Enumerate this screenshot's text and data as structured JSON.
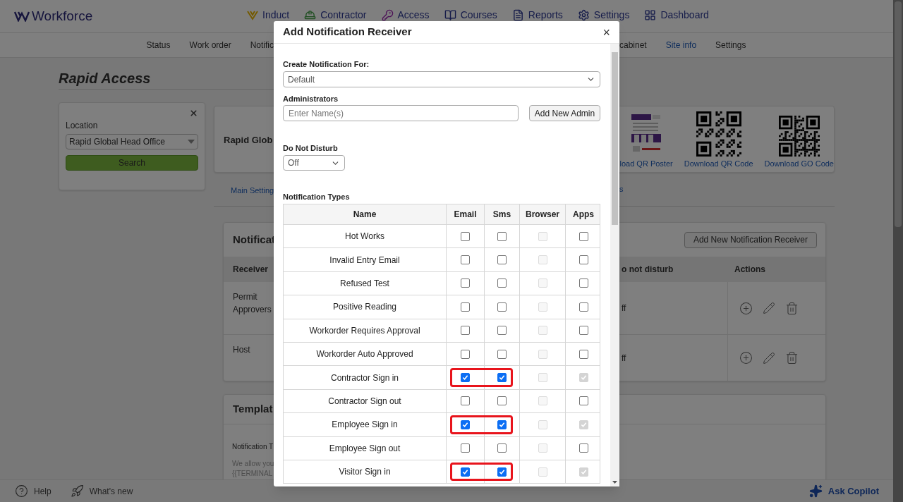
{
  "app": {
    "logo": "Workforce"
  },
  "nav": [
    {
      "label": "Induct",
      "kind": "induct"
    },
    {
      "label": "Contractor",
      "kind": "contractor"
    },
    {
      "label": "Access",
      "kind": "access"
    },
    {
      "label": "Courses",
      "kind": "courses"
    },
    {
      "label": "Reports",
      "kind": "reports"
    },
    {
      "label": "Settings",
      "kind": "settings"
    },
    {
      "label": "Dashboard",
      "kind": "dashboard"
    }
  ],
  "subnav": {
    "left": [
      {
        "label": "Status",
        "selected": false
      },
      {
        "label": "Work order",
        "selected": false
      },
      {
        "label": "Notific",
        "selected": false
      }
    ],
    "right": [
      {
        "label": "cabinet",
        "selected": false
      },
      {
        "label": "Site info",
        "selected": true
      },
      {
        "label": "Settings",
        "selected": false
      }
    ]
  },
  "page": {
    "title": "Rapid Access"
  },
  "location_panel": {
    "label": "Location",
    "value": "Rapid Global Head Office",
    "button": "Search"
  },
  "site_card": {
    "name": "Rapid Glob",
    "downloads": [
      {
        "label": "load QR Poster",
        "kind": "poster"
      },
      {
        "label": "Download QR Code",
        "kind": "qr"
      },
      {
        "label": "Download GO Code",
        "kind": "go"
      }
    ]
  },
  "tabs": [
    {
      "label": "Main Setting"
    },
    {
      "label": "s"
    }
  ],
  "notifications_card": {
    "title": "Notificat",
    "button": "Add New Notification Receiver",
    "columns": [
      "Receiver",
      "o not disturb",
      "Actions"
    ],
    "rows": [
      {
        "receiver": "Permit Approvers",
        "dnd": "ff"
      },
      {
        "receiver": "Host",
        "dnd": "ff"
      }
    ]
  },
  "template_card": {
    "title": "Templat",
    "label": "Notification T",
    "lines": [
      "We allow you",
      "{{TERMINAL"
    ]
  },
  "footer": {
    "help": "Help",
    "whats_new": "What's new",
    "copilot": "Ask Copilot"
  },
  "modal": {
    "title": "Add Notification Receiver",
    "close": "×",
    "create_for": {
      "label": "Create Notification For:",
      "value": "Default"
    },
    "administrators": {
      "label": "Administrators",
      "placeholder": "Enter Name(s)",
      "button": "Add New Admin"
    },
    "do_not_disturb": {
      "label": "Do Not Disturb",
      "value": "Off"
    },
    "types_label": "Notification Types",
    "columns": [
      "Name",
      "Email",
      "Sms",
      "Browser",
      "Apps"
    ],
    "rows": [
      {
        "name": "Hot Works",
        "highlighted": false,
        "email": {
          "checked": false,
          "disabled": false
        },
        "sms": {
          "checked": false,
          "disabled": false
        },
        "browser": {
          "checked": false,
          "disabled": true
        },
        "apps": {
          "checked": false,
          "disabled": false
        }
      },
      {
        "name": "Invalid Entry Email",
        "highlighted": false,
        "email": {
          "checked": false,
          "disabled": false
        },
        "sms": {
          "checked": false,
          "disabled": false
        },
        "browser": {
          "checked": false,
          "disabled": true
        },
        "apps": {
          "checked": false,
          "disabled": false
        }
      },
      {
        "name": "Refused Test",
        "highlighted": false,
        "email": {
          "checked": false,
          "disabled": false
        },
        "sms": {
          "checked": false,
          "disabled": false
        },
        "browser": {
          "checked": false,
          "disabled": true
        },
        "apps": {
          "checked": false,
          "disabled": false
        }
      },
      {
        "name": "Positive Reading",
        "highlighted": false,
        "email": {
          "checked": false,
          "disabled": false
        },
        "sms": {
          "checked": false,
          "disabled": false
        },
        "browser": {
          "checked": false,
          "disabled": true
        },
        "apps": {
          "checked": false,
          "disabled": false
        }
      },
      {
        "name": "Workorder Requires Approval",
        "highlighted": false,
        "email": {
          "checked": false,
          "disabled": false
        },
        "sms": {
          "checked": false,
          "disabled": false
        },
        "browser": {
          "checked": false,
          "disabled": true
        },
        "apps": {
          "checked": false,
          "disabled": false
        }
      },
      {
        "name": "Workorder Auto Approved",
        "highlighted": false,
        "email": {
          "checked": false,
          "disabled": false
        },
        "sms": {
          "checked": false,
          "disabled": false
        },
        "browser": {
          "checked": false,
          "disabled": true
        },
        "apps": {
          "checked": false,
          "disabled": false
        }
      },
      {
        "name": "Contractor Sign in",
        "highlighted": true,
        "email": {
          "checked": true,
          "disabled": false
        },
        "sms": {
          "checked": true,
          "disabled": false
        },
        "browser": {
          "checked": false,
          "disabled": true
        },
        "apps": {
          "checked": true,
          "disabled": true
        }
      },
      {
        "name": "Contractor Sign out",
        "highlighted": false,
        "email": {
          "checked": false,
          "disabled": false
        },
        "sms": {
          "checked": false,
          "disabled": false
        },
        "browser": {
          "checked": false,
          "disabled": true
        },
        "apps": {
          "checked": false,
          "disabled": false
        }
      },
      {
        "name": "Employee Sign in",
        "highlighted": true,
        "email": {
          "checked": true,
          "disabled": false
        },
        "sms": {
          "checked": true,
          "disabled": false
        },
        "browser": {
          "checked": false,
          "disabled": true
        },
        "apps": {
          "checked": true,
          "disabled": true
        }
      },
      {
        "name": "Employee Sign out",
        "highlighted": false,
        "email": {
          "checked": false,
          "disabled": false
        },
        "sms": {
          "checked": false,
          "disabled": false
        },
        "browser": {
          "checked": false,
          "disabled": true
        },
        "apps": {
          "checked": false,
          "disabled": false
        }
      },
      {
        "name": "Visitor Sign in",
        "highlighted": true,
        "email": {
          "checked": true,
          "disabled": false
        },
        "sms": {
          "checked": true,
          "disabled": false
        },
        "browser": {
          "checked": false,
          "disabled": true
        },
        "apps": {
          "checked": true,
          "disabled": true
        }
      }
    ]
  }
}
